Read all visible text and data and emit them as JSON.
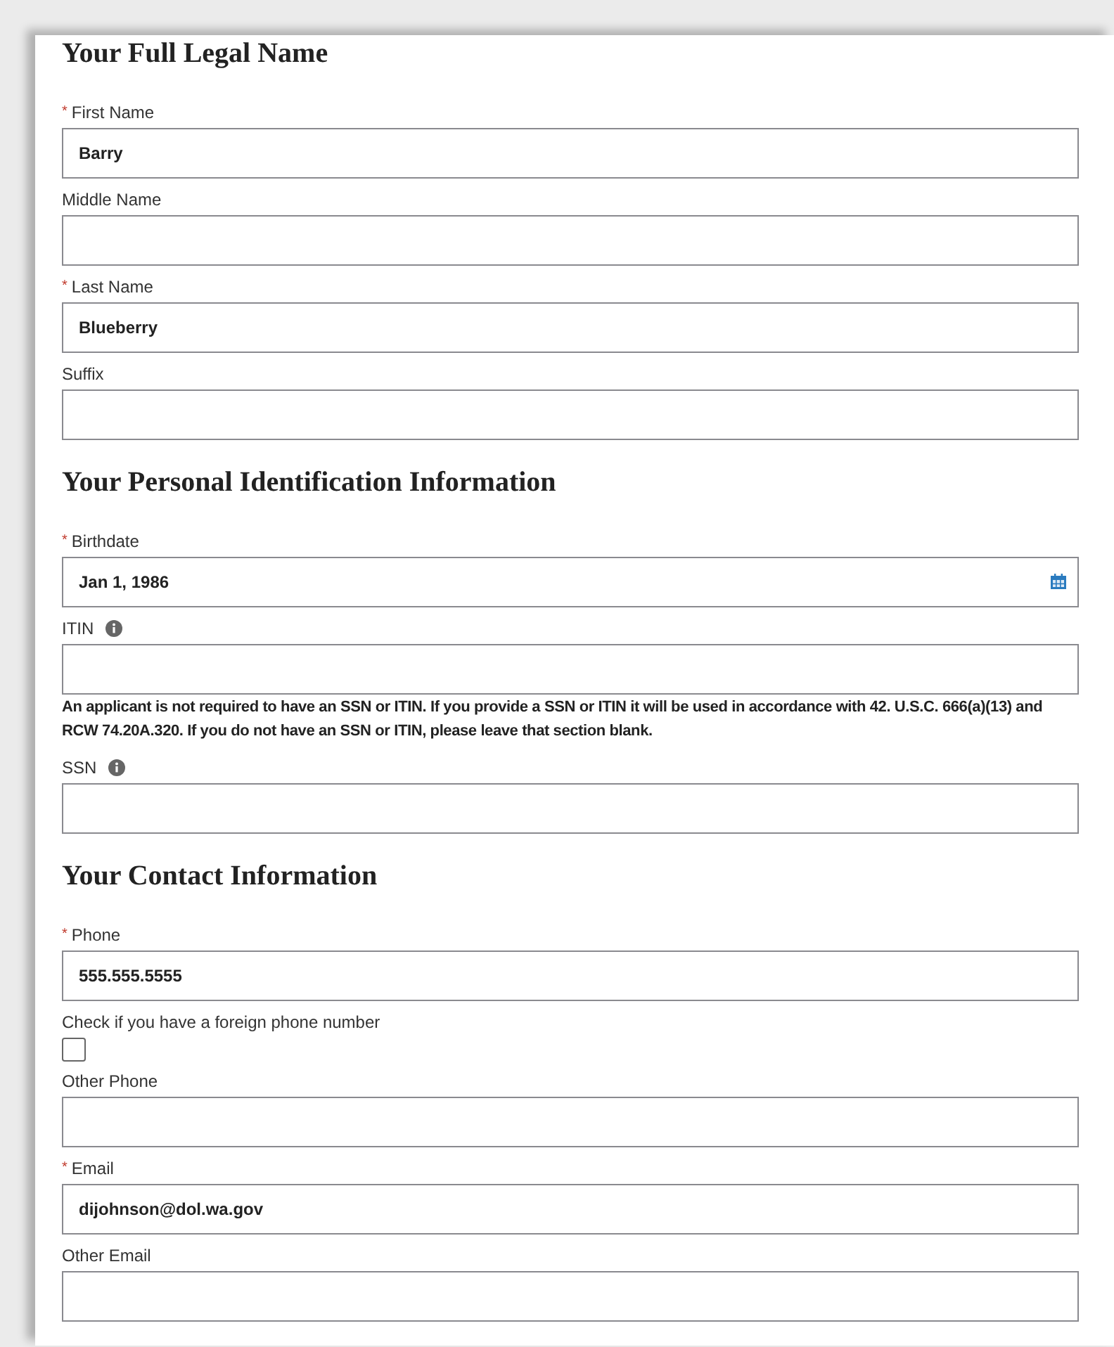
{
  "sections": [
    {
      "heading": "Your Full Legal Name",
      "items": [
        {
          "kind": "field",
          "marker": "*",
          "label": "First Name",
          "value": "Barry"
        },
        {
          "kind": "field",
          "label": "Middle Name"
        },
        {
          "kind": "field",
          "marker": "*",
          "label": "Last Name",
          "value": "Blueberry"
        },
        {
          "kind": "field",
          "label": "Suffix"
        }
      ]
    },
    {
      "heading": "Your Personal Identification Information",
      "items": [
        {
          "kind": "date",
          "marker": "*",
          "label": "Birthdate",
          "value": "Jan 1, 1986"
        },
        {
          "kind": "field",
          "label": "ITIN",
          "info": true
        },
        {
          "kind": "note",
          "text": "An applicant is not required to have an SSN or ITIN. If you provide a SSN or ITIN it will be used in accordance with 42. U.S.C. 666(a)(13) and RCW 74.20A.320. If you do not have an SSN or ITIN, please leave that section blank."
        },
        {
          "kind": "field",
          "label": "SSN",
          "info": true
        }
      ]
    },
    {
      "heading": "Your Contact Information",
      "items": [
        {
          "kind": "field",
          "marker": "*",
          "label": "Phone",
          "value": "555.555.5555"
        },
        {
          "kind": "checkbox",
          "label": "Check if you have a foreign phone number",
          "checked": false
        },
        {
          "kind": "field",
          "label": "Other Phone"
        },
        {
          "kind": "field",
          "marker": "*",
          "label": "Email",
          "value": "dijohnson@dol.wa.gov"
        },
        {
          "kind": "field",
          "label": "Other Email"
        }
      ]
    }
  ]
}
